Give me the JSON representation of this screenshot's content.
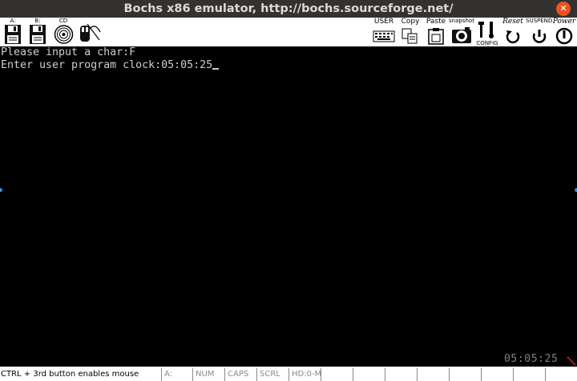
{
  "window": {
    "title": "Bochs x86 emulator, http://bochs.sourceforge.net/"
  },
  "toolbar": {
    "floppy_a": "A:",
    "floppy_b": "B:",
    "cdrom": "CD",
    "user": "USER",
    "copy": "Copy",
    "paste": "Paste",
    "snapshot": "snapshot",
    "config": "CONFIG",
    "reset": "Reset",
    "suspend": "SUSPEND",
    "power": "Power"
  },
  "screen": {
    "line1": "Please input a char:F",
    "line2": "Enter user program clock:05:05:25",
    "clock": "05:05:25"
  },
  "statusbar": {
    "message": "CTRL + 3rd button enables mouse",
    "drive_a": "A:",
    "num": "NUM",
    "caps": "CAPS",
    "scrl": "SCRL",
    "hd": "HD:0-M"
  },
  "colors": {
    "titlebar": "#333231",
    "close_button": "#e95420",
    "screen_text": "#cfcfcf",
    "clock_text": "#808080"
  }
}
